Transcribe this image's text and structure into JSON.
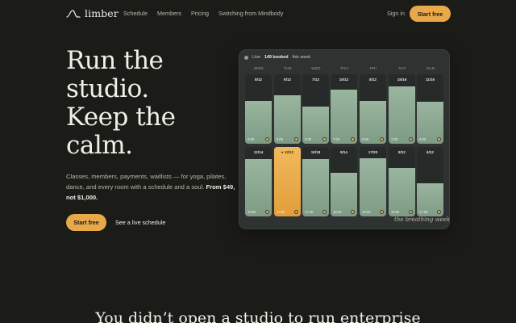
{
  "brand": {
    "name": "limber",
    "accent": "#e8a94a",
    "background": "#1b1b18"
  },
  "nav": {
    "links": [
      "Schedule",
      "Members",
      "Pricing",
      "Switching from Mindbody"
    ],
    "signin": "Sign in",
    "cta": "Start free"
  },
  "hero": {
    "headline": [
      "Run the",
      "studio.",
      "Keep the",
      "calm."
    ],
    "sub": "Classes, members, payments, waitlists — for yoga, pilates, dance, and every room with a schedule and a soul.",
    "sub_bold": "From $49, not $1,000.",
    "cta": "Start free",
    "secondary": "See a live schedule"
  },
  "widget": {
    "live": "Live",
    "booked": "149 booked",
    "period": "this week",
    "days": [
      "MON",
      "TUE",
      "WED",
      "THU",
      "FRI",
      "SAT",
      "SUN"
    ],
    "rows": [
      [
        {
          "cap": "8/12",
          "time": "6:00",
          "level": 0.62
        },
        {
          "cap": "9/12",
          "time": "6:00",
          "level": 0.7
        },
        {
          "cap": "7/12",
          "time": "6:30",
          "level": 0.53
        },
        {
          "cap": "10/12",
          "time": "7:00",
          "level": 0.78
        },
        {
          "cap": "8/12",
          "time": "6:00",
          "level": 0.62
        },
        {
          "cap": "15/16",
          "time": "7:30",
          "level": 0.82
        },
        {
          "cap": "11/16",
          "time": "9:00",
          "level": 0.6
        }
      ],
      [
        {
          "cap": "12/14",
          "time": "18:00",
          "level": 0.82
        },
        {
          "cap": "● 12/12",
          "time": "18:00",
          "level": 1.0,
          "active": true
        },
        {
          "cap": "10/18",
          "time": "17:30",
          "level": 0.82
        },
        {
          "cap": "9/14",
          "time": "18:00",
          "level": 0.63
        },
        {
          "cap": "17/20",
          "time": "18:00",
          "level": 0.84
        },
        {
          "cap": "8/12",
          "time": "11:00",
          "level": 0.7
        },
        {
          "cap": "6/12",
          "time": "17:00",
          "level": 0.48
        }
      ]
    ],
    "caption": "the breathing week"
  },
  "section2": {
    "heading": "You didn’t open a studio to run enterprise"
  }
}
